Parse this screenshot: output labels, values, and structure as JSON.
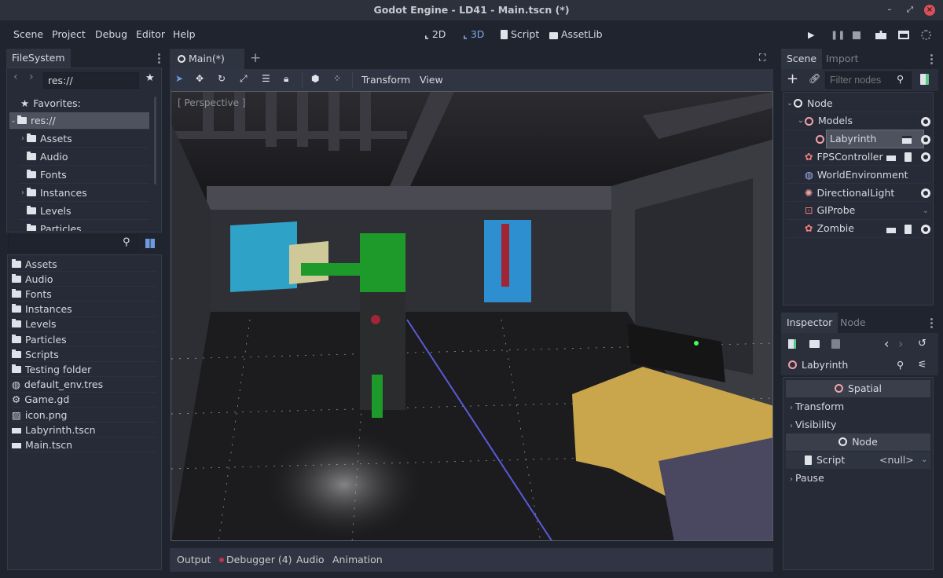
{
  "window": {
    "title": "Godot Engine - LD41 - Main.tscn (*)",
    "controls": [
      "minimize",
      "maximize",
      "close"
    ]
  },
  "menu": {
    "items": [
      "Scene",
      "Project",
      "Debug",
      "Editor",
      "Help"
    ]
  },
  "modes": {
    "items": [
      {
        "label": "2D",
        "icon": "2d-axes-icon",
        "active": false
      },
      {
        "label": "3D",
        "icon": "3d-axes-icon",
        "active": true
      },
      {
        "label": "Script",
        "icon": "script-icon",
        "active": false
      },
      {
        "label": "AssetLib",
        "icon": "assetlib-icon",
        "active": false
      }
    ],
    "accent_color": "#7ea8e6"
  },
  "playback": {
    "buttons": [
      "play-icon",
      "pause-icon",
      "stop-icon",
      "play-scene-icon",
      "play-custom-scene-icon",
      "spinner-icon"
    ]
  },
  "filesystem": {
    "tab_label": "FileSystem",
    "path_value": "res://",
    "tree": [
      {
        "label": "Favorites:",
        "icon": "star-icon",
        "indent": 0,
        "chevron": false
      },
      {
        "label": "res://",
        "icon": "folder-icon",
        "indent": 0,
        "chevron": "down",
        "selected": true
      },
      {
        "label": "Assets",
        "icon": "folder-icon",
        "indent": 1,
        "chevron": "right"
      },
      {
        "label": "Audio",
        "icon": "folder-icon",
        "indent": 1,
        "chevron": false
      },
      {
        "label": "Fonts",
        "icon": "folder-icon",
        "indent": 1,
        "chevron": false
      },
      {
        "label": "Instances",
        "icon": "folder-icon",
        "indent": 1,
        "chevron": "right"
      },
      {
        "label": "Levels",
        "icon": "folder-icon",
        "indent": 1,
        "chevron": false
      },
      {
        "label": "Particles",
        "icon": "folder-icon",
        "indent": 1,
        "chevron": false
      }
    ],
    "search_value": "",
    "files": [
      {
        "label": "Assets",
        "icon": "folder-icon"
      },
      {
        "label": "Audio",
        "icon": "folder-icon"
      },
      {
        "label": "Fonts",
        "icon": "folder-icon"
      },
      {
        "label": "Instances",
        "icon": "folder-icon"
      },
      {
        "label": "Levels",
        "icon": "folder-icon"
      },
      {
        "label": "Particles",
        "icon": "folder-icon"
      },
      {
        "label": "Scripts",
        "icon": "folder-icon"
      },
      {
        "label": "Testing folder",
        "icon": "folder-icon"
      },
      {
        "label": "default_env.tres",
        "icon": "environment-icon"
      },
      {
        "label": "Game.gd",
        "icon": "gear-icon"
      },
      {
        "label": "icon.png",
        "icon": "image-icon"
      },
      {
        "label": "Labyrinth.tscn",
        "icon": "scene-icon"
      },
      {
        "label": "Main.tscn",
        "icon": "scene-icon"
      }
    ]
  },
  "editor": {
    "scene_tab": "Main(*)",
    "toolbar_menus": [
      "Transform",
      "View"
    ],
    "viewport_label": "[ Perspective ]"
  },
  "bottom_panel": {
    "tabs": [
      {
        "label": "Output"
      },
      {
        "label": "Debugger (4)",
        "badge_color": "#c0334f"
      },
      {
        "label": "Audio"
      },
      {
        "label": "Animation"
      }
    ]
  },
  "scene_dock": {
    "tabs": [
      "Scene",
      "Import"
    ],
    "filter_placeholder": "Filter nodes",
    "nodes": [
      {
        "label": "Node",
        "icon": "node-icon",
        "indent": 0,
        "chevron": "down",
        "visible": null
      },
      {
        "label": "Models",
        "icon": "spatial-icon",
        "indent": 1,
        "chevron": "down",
        "visible": true
      },
      {
        "label": "Labyrinth",
        "icon": "spatial-icon",
        "indent": 2,
        "selected": true,
        "instance": true,
        "visible": true
      },
      {
        "label": "FPSController",
        "icon": "kinematic-body-icon",
        "indent": 1,
        "instance": true,
        "script": true,
        "visible": true
      },
      {
        "label": "WorldEnvironment",
        "icon": "world-environment-icon",
        "indent": 1,
        "visible": null
      },
      {
        "label": "DirectionalLight",
        "icon": "directional-light-icon",
        "indent": 1,
        "visible": true
      },
      {
        "label": "GIProbe",
        "icon": "giprobe-icon",
        "indent": 1,
        "visible": null,
        "collapsed_hint": true
      },
      {
        "label": "Zombie",
        "icon": "kinematic-body-icon",
        "indent": 1,
        "instance": true,
        "script": true,
        "visible": true
      }
    ]
  },
  "inspector": {
    "tabs": [
      "Inspector",
      "Node"
    ],
    "object_name": "Labyrinth",
    "sections": [
      {
        "type": "header",
        "label": "Spatial",
        "icon": "spatial-icon"
      },
      {
        "type": "group",
        "label": "Transform"
      },
      {
        "type": "group",
        "label": "Visibility"
      },
      {
        "type": "header",
        "label": "Node",
        "icon": "node-icon"
      },
      {
        "type": "property",
        "label": "Script",
        "value": "<null>"
      },
      {
        "type": "group",
        "label": "Pause"
      }
    ]
  }
}
